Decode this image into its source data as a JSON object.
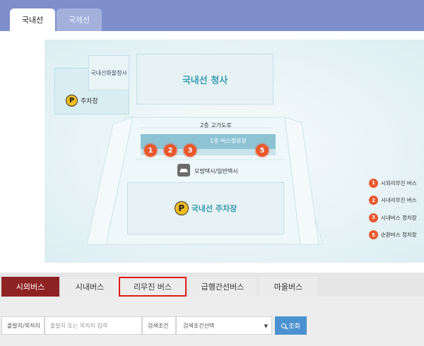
{
  "top_tabs": [
    {
      "label": "국내선",
      "active": true
    },
    {
      "label": "국제선",
      "active": false
    }
  ],
  "map": {
    "cargo_terminal": "국내선화물청사",
    "parking_small": "주차장",
    "domestic_terminal": "국내선 청사",
    "overpass": "2층 고가도로",
    "bus_stop_floor1": "1층 버스정류장",
    "taxi": "모범택시/일반택시",
    "domestic_parking": "국내선 주차장",
    "parking_symbol": "P",
    "stops": [
      "1",
      "2",
      "3",
      "5"
    ],
    "legend": [
      {
        "num": "1",
        "label": "시외리무진 버스"
      },
      {
        "num": "2",
        "label": "시내리무진 버스"
      },
      {
        "num": "3",
        "label": "시내버스 정차장"
      },
      {
        "num": "5",
        "label": "순환버스 정차장"
      }
    ],
    "colors": {
      "stop_marker": "#e8572d",
      "building_text": "#3a9bb0",
      "parking_icon": "#f3bc1c"
    }
  },
  "bus_tabs": [
    {
      "label": "시외버스",
      "active": true
    },
    {
      "label": "시내버스",
      "active": false
    },
    {
      "label": "리무진 버스",
      "active": false,
      "highlighted": true
    },
    {
      "label": "급행간선버스",
      "active": false
    },
    {
      "label": "마을버스",
      "active": false
    }
  ],
  "search": {
    "route_label": "출발지/목적지",
    "route_placeholder": "출발지 또는 목적지 입력",
    "condition_label": "검색조건",
    "condition_selected": "검색조건선택",
    "submit_label": "조회"
  },
  "colors": {
    "tab_bar": "#7f8fcc",
    "active_bus_tab": "#8e2324",
    "highlight_border": "#e01b1b",
    "search_button": "#4d92d0"
  }
}
